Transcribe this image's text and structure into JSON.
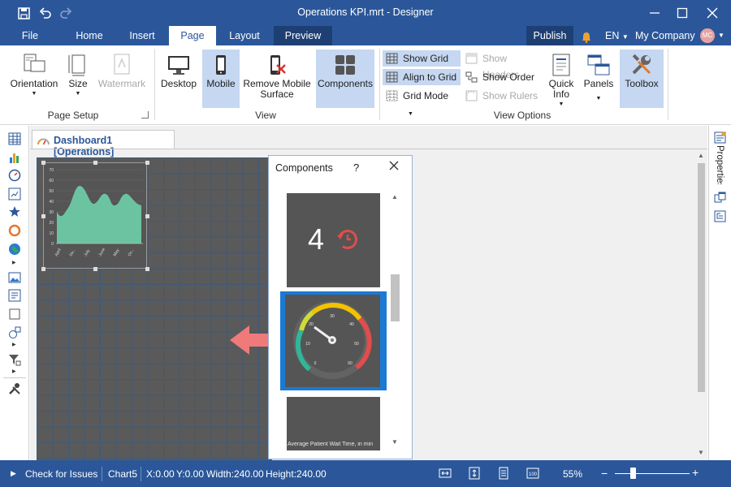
{
  "window": {
    "title": "Operations KPI.mrt - Designer"
  },
  "tabs": {
    "file": "File",
    "home": "Home",
    "insert": "Insert",
    "page": "Page",
    "layout": "Layout",
    "preview": "Preview",
    "publish": "Publish",
    "language": "EN",
    "company": "My Company",
    "avatar_initials": "MC"
  },
  "ribbon": {
    "page_setup": {
      "orientation": "Orientation",
      "size": "Size",
      "watermark": "Watermark",
      "group_label": "Page Setup"
    },
    "view": {
      "desktop": "Desktop",
      "mobile": "Mobile",
      "remove_mobile_line1": "Remove Mobile",
      "remove_mobile_line2": "Surface",
      "components": "Components",
      "group_label": "View"
    },
    "view_options": {
      "show_grid": "Show Grid",
      "align_to_grid": "Align to Grid",
      "grid_mode": "Grid Mode",
      "show_headers": "Show Headers",
      "show_order": "Show Order",
      "show_rulers": "Show Rulers",
      "quick_info_line1": "Quick",
      "quick_info_line2": "Info",
      "panels": "Panels",
      "toolbox": "Toolbox",
      "group_label": "View Options"
    }
  },
  "document": {
    "tab_label": "Dashboard1 [Operations]"
  },
  "chart_widget": {
    "y_ticks": [
      "70",
      "60",
      "50",
      "40",
      "30",
      "20",
      "10",
      "0"
    ],
    "x_ticks": [
      "April",
      "De..",
      "July",
      "June",
      "May",
      "Oc.."
    ]
  },
  "components_panel": {
    "title": "Components",
    "help": "?",
    "indicator_value": "4",
    "gauge_ticks": [
      "0",
      "10",
      "20",
      "30",
      "40",
      "50",
      "60"
    ],
    "wait_time_label": "Average Patient Wait Time, in min"
  },
  "right_panel": {
    "properties_label": "Properties"
  },
  "statusbar": {
    "check_issues": "Check for Issues",
    "component": "Chart5",
    "x": "X:0.00",
    "y": "Y:0.00",
    "width": "Width:240.00",
    "height": "Height:240.00",
    "zoom": "55%",
    "zoom_minus": "−",
    "zoom_plus": "+"
  },
  "colors": {
    "accent": "#2b579a",
    "selection": "#c5d7f1",
    "canvas": "#5a5a5a",
    "area_fill": "#6cc3a1",
    "arrow": "#f07a7a"
  }
}
